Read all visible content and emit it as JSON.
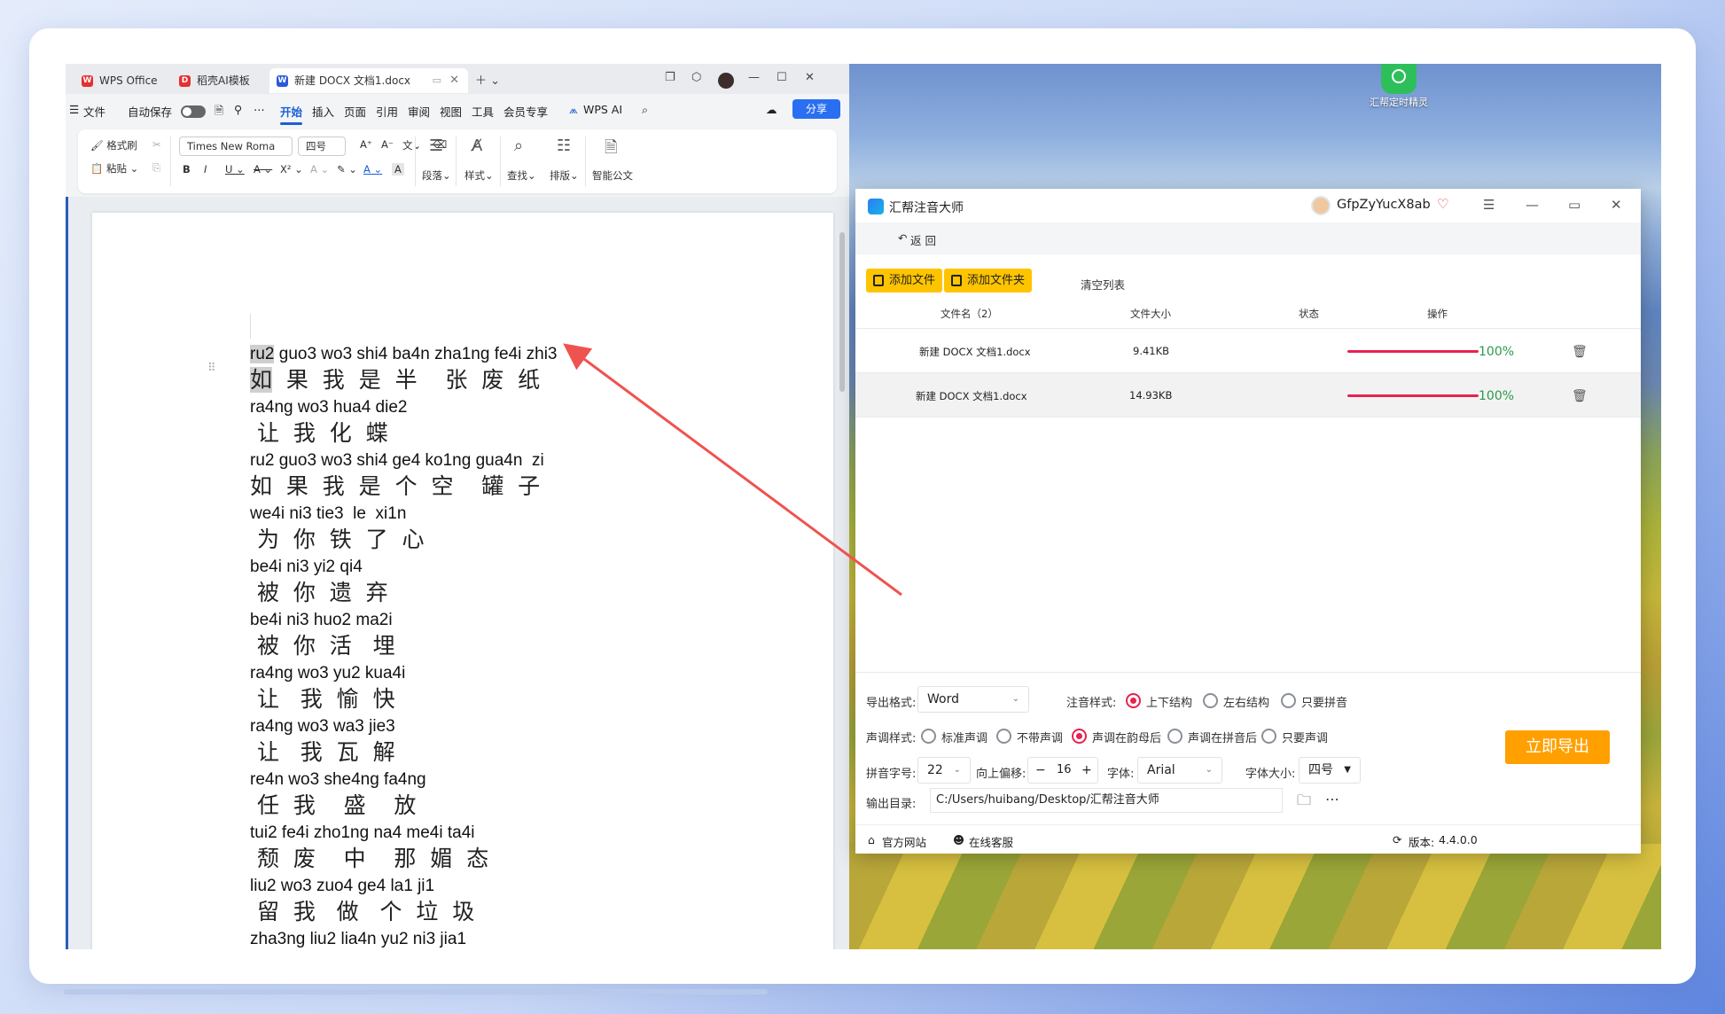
{
  "wps": {
    "tabs": [
      {
        "label": "WPS Office",
        "icon": "wps-logo-icon",
        "color": "#e5302f"
      },
      {
        "label": "稻壳AI模板",
        "icon": "docer-icon",
        "color": "#e5302f"
      },
      {
        "label": "新建 DOCX 文档1.docx",
        "icon": "word-doc-icon",
        "color": "#2a5bd7"
      }
    ],
    "menu": {
      "file": "文件",
      "autosave": "自动保存",
      "items": [
        "开始",
        "插入",
        "页面",
        "引用",
        "审阅",
        "视图",
        "工具",
        "会员专享"
      ],
      "active": "开始",
      "wps_ai": "WPS AI",
      "share": "分享"
    },
    "ribbon": {
      "format_painter": "格式刷",
      "paste": "粘贴",
      "font_name": "Times New Roma",
      "font_size": "四号",
      "paragraph": "段落",
      "styles": "样式",
      "find": "查找",
      "layout": "排版",
      "smart_doc": "智能公文"
    },
    "document_lines": [
      {
        "pinyin": "ru2 guo3 wo3 shi4 ba4n zha1ng fe4i zhi3",
        "hanzi": "如  果  我  是  半    张  废  纸"
      },
      {
        "pinyin": "ra4ng wo3 hua4 die2",
        "hanzi": " 让  我  化  蝶"
      },
      {
        "pinyin": "ru2 guo3 wo3 shi4 ge4 ko1ng gua4n  zi",
        "hanzi": "如  果  我  是  个  空    罐  子"
      },
      {
        "pinyin": "we4i ni3 tie3  le  xi1n",
        "hanzi": " 为  你  铁  了  心"
      },
      {
        "pinyin": "be4i ni3 yi2 qi4",
        "hanzi": " 被  你  遗  弃"
      },
      {
        "pinyin": "be4i ni3 huo2 ma2i",
        "hanzi": " 被  你  活   埋"
      },
      {
        "pinyin": "ra4ng wo3 yu2 kua4i",
        "hanzi": " 让   我  愉  快"
      },
      {
        "pinyin": "ra4ng wo3 wa3 jie3",
        "hanzi": " 让   我  瓦  解"
      },
      {
        "pinyin": "re4n wo3 she4ng fa4ng",
        "hanzi": " 任  我    盛    放"
      },
      {
        "pinyin": "tui2 fe4i zho1ng na4 me4i ta4i",
        "hanzi": " 颓  废    中    那  媚  态"
      },
      {
        "pinyin": "liu2 wo3 zuo4 ge4 la1 ji1",
        "hanzi": " 留  我   做   个  垃  圾"
      },
      {
        "pinyin": "zha3ng liu2 lia4n yu2 ni3 jia1",
        "hanzi": ""
      }
    ]
  },
  "desktop": {
    "icon_label": "汇帮定时精灵"
  },
  "app": {
    "title": "汇帮注音大师",
    "username": "GfpZyYucX8ab",
    "back": "返 回",
    "buttons": {
      "add_file": "添加文件",
      "add_folder": "添加文件夹",
      "clear_list": "清空列表"
    },
    "table": {
      "headers": [
        "文件名（2）",
        "文件大小",
        "状态",
        "操作"
      ],
      "rows": [
        {
          "name": "新建 DOCX 文档1.docx",
          "size": "9.41KB",
          "progress": 1.0,
          "status": "100%"
        },
        {
          "name": "新建 DOCX 文档1.docx",
          "size": "14.93KB",
          "progress": 1.0,
          "status": "100%"
        }
      ]
    },
    "settings": {
      "export_format_label": "导出格式:",
      "export_format": "Word",
      "annotation_style_label": "注音样式:",
      "annotation_options": [
        "上下结构",
        "左右结构",
        "只要拼音"
      ],
      "annotation_selected": "上下结构",
      "tone_style_label": "声调样式:",
      "tone_options": [
        "标准声调",
        "不带声调",
        "声调在韵母后",
        "声调在拼音后",
        "只要声调"
      ],
      "tone_selected": "声调在韵母后",
      "pinyin_size_label": "拼音字号:",
      "pinyin_size": "22",
      "offset_label": "向上偏移:",
      "offset_minus": "−",
      "offset_value": "16",
      "offset_plus": "+",
      "font_label": "字体:",
      "font_value": "Arial",
      "font_size_label": "字体大小:",
      "font_size_value": "四号",
      "output_dir_label": "输出目录:",
      "output_dir": "C:/Users/huibang/Desktop/汇帮注音大师",
      "export_now": "立即导出"
    },
    "footer": {
      "website": "官方网站",
      "support": "在线客服",
      "version_label": "版本:",
      "version": "4.4.0.0"
    },
    "accent": "#e7224f",
    "export_color": "#ffa000",
    "button_color": "#ffc400"
  }
}
